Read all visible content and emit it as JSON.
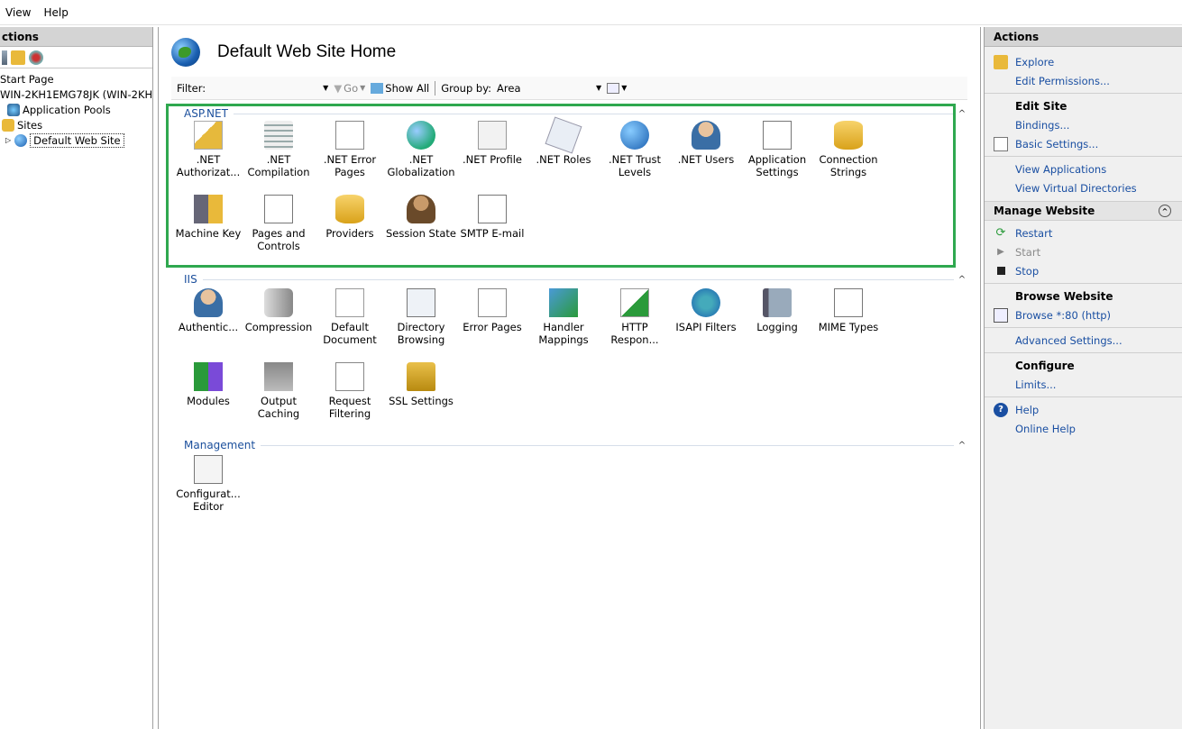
{
  "menubar": {
    "view": "View",
    "help": "Help"
  },
  "left": {
    "header": "ctions",
    "tree": {
      "start_page": "Start Page",
      "server": "WIN-2KH1EMG78JK (WIN-2KH",
      "app_pools": "Application Pools",
      "sites": "Sites",
      "default_site": "Default Web Site"
    }
  },
  "center": {
    "title": "Default Web Site Home",
    "filter_label": "Filter:",
    "go_label": "Go",
    "show_all": "Show All",
    "group_by_label": "Group by:",
    "group_by_value": "Area",
    "groups": {
      "aspnet": "ASP.NET",
      "iis": "IIS",
      "management": "Management"
    },
    "aspnet_features": [
      {
        "l1": ".NET",
        "l2": "Authorizat..."
      },
      {
        "l1": ".NET",
        "l2": "Compilation"
      },
      {
        "l1": ".NET Error",
        "l2": "Pages"
      },
      {
        "l1": ".NET",
        "l2": "Globalization"
      },
      {
        "l1": ".NET Profile",
        "l2": ""
      },
      {
        "l1": ".NET Roles",
        "l2": ""
      },
      {
        "l1": ".NET Trust",
        "l2": "Levels"
      },
      {
        "l1": ".NET Users",
        "l2": ""
      },
      {
        "l1": "Application",
        "l2": "Settings"
      },
      {
        "l1": "Connection",
        "l2": "Strings"
      },
      {
        "l1": "Machine Key",
        "l2": ""
      },
      {
        "l1": "Pages and",
        "l2": "Controls"
      },
      {
        "l1": "Providers",
        "l2": ""
      },
      {
        "l1": "Session State",
        "l2": ""
      },
      {
        "l1": "SMTP E-mail",
        "l2": ""
      }
    ],
    "iis_features": [
      {
        "l1": "Authentic...",
        "l2": ""
      },
      {
        "l1": "Compression",
        "l2": ""
      },
      {
        "l1": "Default",
        "l2": "Document"
      },
      {
        "l1": "Directory",
        "l2": "Browsing"
      },
      {
        "l1": "Error Pages",
        "l2": ""
      },
      {
        "l1": "Handler",
        "l2": "Mappings"
      },
      {
        "l1": "HTTP",
        "l2": "Respon..."
      },
      {
        "l1": "ISAPI Filters",
        "l2": ""
      },
      {
        "l1": "Logging",
        "l2": ""
      },
      {
        "l1": "MIME Types",
        "l2": ""
      },
      {
        "l1": "Modules",
        "l2": ""
      },
      {
        "l1": "Output",
        "l2": "Caching"
      },
      {
        "l1": "Request",
        "l2": "Filtering"
      },
      {
        "l1": "SSL Settings",
        "l2": ""
      }
    ],
    "management_features": [
      {
        "l1": "Configurat...",
        "l2": "Editor"
      }
    ]
  },
  "right": {
    "header": "Actions",
    "explore": "Explore",
    "edit_permissions": "Edit Permissions...",
    "edit_site": "Edit Site",
    "bindings": "Bindings...",
    "basic_settings": "Basic Settings...",
    "view_applications": "View Applications",
    "view_virtual_dirs": "View Virtual Directories",
    "manage_website": "Manage Website",
    "restart": "Restart",
    "start": "Start",
    "stop": "Stop",
    "browse_website": "Browse Website",
    "browse_80": "Browse *:80 (http)",
    "advanced_settings": "Advanced Settings...",
    "configure": "Configure",
    "limits": "Limits...",
    "help": "Help",
    "online_help": "Online Help"
  }
}
